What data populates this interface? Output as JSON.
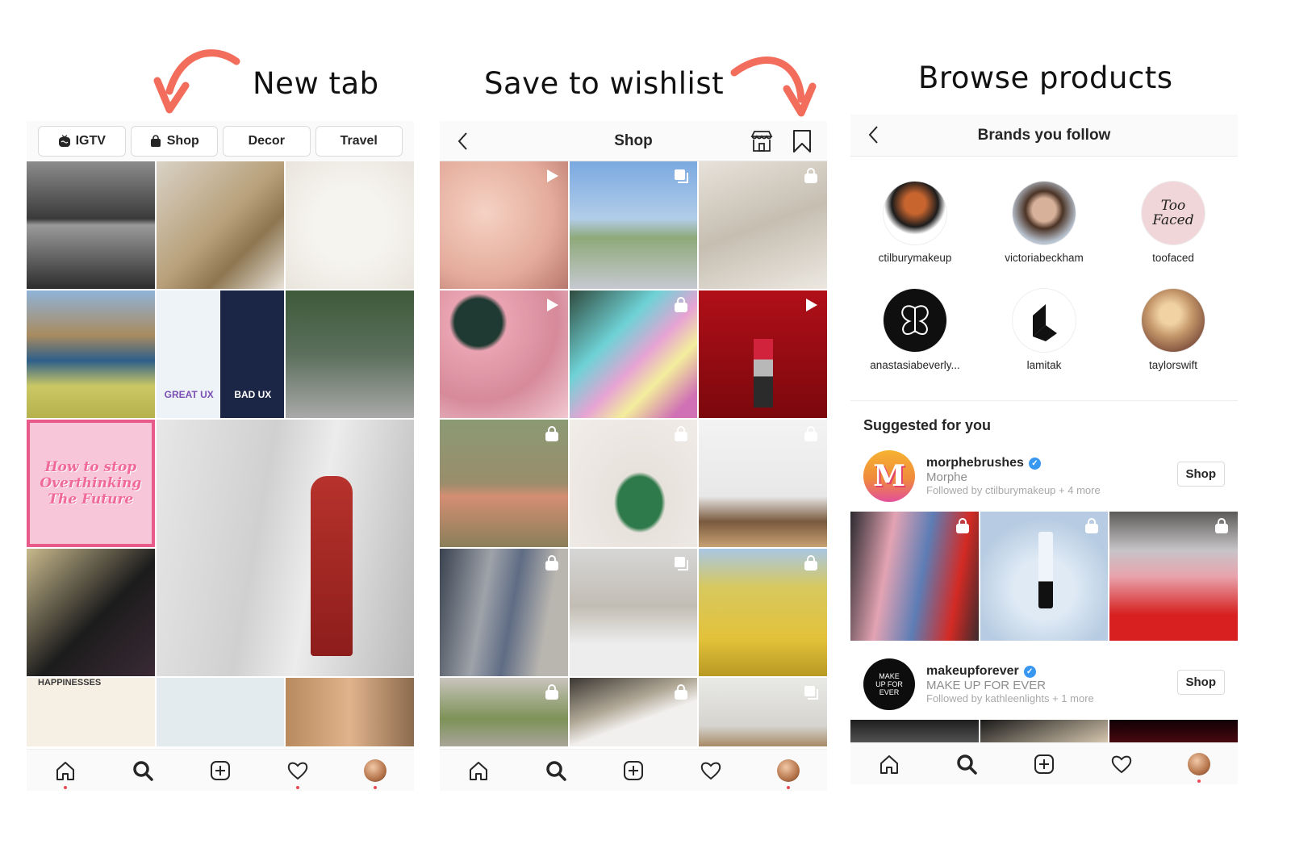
{
  "captions": {
    "panel1": "New tab",
    "panel2": "Save to wishlist",
    "panel3": "Browse products"
  },
  "accent_color": "#f26d5b",
  "panel1": {
    "tabs": [
      {
        "label": "IGTV",
        "icon": "igtv-icon"
      },
      {
        "label": "Shop",
        "icon": "shopping-bag-icon"
      },
      {
        "label": "Decor",
        "icon": ""
      },
      {
        "label": "Travel",
        "icon": ""
      }
    ],
    "grid_posts": [
      {
        "desc": "Black and white couple photo",
        "badge": "carousel-icon"
      },
      {
        "desc": "Woman in gold dress on staircase",
        "badge": "carousel-icon"
      },
      {
        "desc": "Inner alchemy illustration",
        "badge": "carousel-icon"
      },
      {
        "desc": "Woman in yellow gown by sea",
        "badge": "carousel-icon"
      },
      {
        "desc": "Real UX vs Fake UX",
        "text_left": "GREAT UX",
        "text_right": "BAD UX",
        "badge": ""
      },
      {
        "desc": "Man and child walking",
        "badge": ""
      },
      {
        "desc": "How to stop overthinking the future",
        "text": "How to stop Overthinking The Future",
        "badge": "carousel-icon"
      },
      {
        "desc": "Woman in red gown (large tile)",
        "badge": ""
      },
      {
        "desc": "Couple portrait",
        "badge": "carousel-icon"
      },
      {
        "desc": "Happinesses in daily life",
        "text": "HAPPINESSES",
        "badge": "carousel-icon"
      },
      {
        "desc": "Laptop illustration",
        "badge": "carousel-icon"
      },
      {
        "desc": "Actor comparison",
        "badge": ""
      }
    ]
  },
  "panel2": {
    "header_title": "Shop",
    "grid_posts": [
      {
        "desc": "Makeup swatch face",
        "badge": "video-icon"
      },
      {
        "desc": "Woman on rooftop",
        "badge": "carousel-icon"
      },
      {
        "desc": "Smiling baby with bow",
        "badge": "shopping-bag-icon"
      },
      {
        "desc": "Glitter brush",
        "badge": "video-icon"
      },
      {
        "desc": "Tie-dye fabric",
        "badge": "shopping-bag-icon"
      },
      {
        "desc": "Red lipstick",
        "badge": "video-icon"
      },
      {
        "desc": "Woman in pink dress in field",
        "badge": "shopping-bag-icon"
      },
      {
        "desc": "Monstera leaf keychain",
        "badge": "shopping-bag-icon"
      },
      {
        "desc": "Woman in jeans indoors",
        "badge": "shopping-bag-icon"
      },
      {
        "desc": "Woman with poncho on street",
        "badge": "shopping-bag-icon"
      },
      {
        "desc": "Reading pillow",
        "badge": "carousel-icon"
      },
      {
        "desc": "Woman in flower field",
        "badge": "shopping-bag-icon"
      },
      {
        "desc": "Twin babies",
        "badge": "shopping-bag-icon"
      },
      {
        "desc": "Fur blanket",
        "badge": "shopping-bag-icon"
      },
      {
        "desc": "Sewing machine",
        "badge": "carousel-icon"
      }
    ]
  },
  "panel3": {
    "header_title": "Brands you follow",
    "brands": [
      {
        "name": "ctilburymakeup"
      },
      {
        "name": "victoriabeckham"
      },
      {
        "name": "toofaced",
        "logo_text": "Too Faced"
      },
      {
        "name": "anastasiabeverly..."
      },
      {
        "name": "lamitak"
      },
      {
        "name": "taylorswift"
      }
    ],
    "suggested_title": "Suggested for you",
    "suggestions": [
      {
        "username": "morphebrushes",
        "full_name": "Morphe",
        "followed_by": "Followed by ctilburymakeup + 4 more",
        "button": "Shop",
        "verified": true,
        "avatar_text": "M"
      },
      {
        "username": "makeupforever",
        "full_name": "MAKE UP FOR EVER",
        "followed_by": "Followed by kathleenlights + 1 more",
        "button": "Shop",
        "verified": true,
        "avatar_text": "MAKE UP FOR EVER"
      }
    ]
  },
  "navbar": {
    "items": [
      "home-icon",
      "search-icon",
      "new-post-icon",
      "activity-heart-icon",
      "profile-avatar"
    ]
  }
}
